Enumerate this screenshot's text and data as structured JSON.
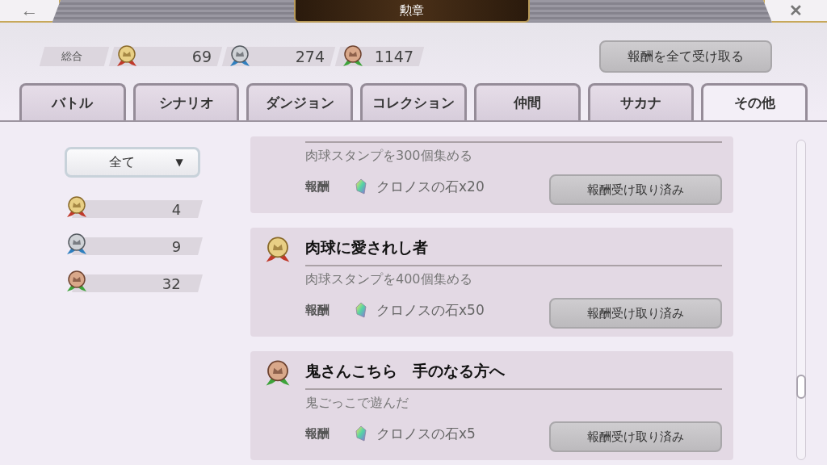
{
  "header": {
    "back": "←",
    "title": "勲章",
    "close": "✕"
  },
  "totals": {
    "label": "総合",
    "counts": [
      {
        "kind": "gold",
        "value": "69"
      },
      {
        "kind": "silver",
        "value": "274"
      },
      {
        "kind": "bronze",
        "value": "1147"
      }
    ]
  },
  "claim_all": "報酬を全て受け取る",
  "tabs": [
    {
      "label": "バトル",
      "selected": false
    },
    {
      "label": "シナリオ",
      "selected": false
    },
    {
      "label": "ダンジョン",
      "selected": false
    },
    {
      "label": "コレクション",
      "selected": false
    },
    {
      "label": "仲間",
      "selected": false
    },
    {
      "label": "サカナ",
      "selected": false
    },
    {
      "label": "その他",
      "selected": true
    }
  ],
  "filter": {
    "value": "全て",
    "caret": "▼"
  },
  "tier_counts": [
    {
      "kind": "gold",
      "value": "4"
    },
    {
      "kind": "silver",
      "value": "9"
    },
    {
      "kind": "bronze",
      "value": "32"
    }
  ],
  "achievements": [
    {
      "description": "肉球スタンプを300個集める",
      "reward_label": "報酬",
      "reward": "クロノスの石x20",
      "button": "報酬受け取り済み"
    },
    {
      "kind": "gold",
      "title": "肉球に愛されし者",
      "description": "肉球スタンプを400個集める",
      "reward_label": "報酬",
      "reward": "クロノスの石x50",
      "button": "報酬受け取り済み"
    },
    {
      "kind": "bronze",
      "title": "鬼さんこちら　手のなる方へ",
      "description": "鬼ごっこで遊んだ",
      "reward_label": "報酬",
      "reward": "クロノスの石x5",
      "button": "報酬受け取り済み"
    }
  ]
}
